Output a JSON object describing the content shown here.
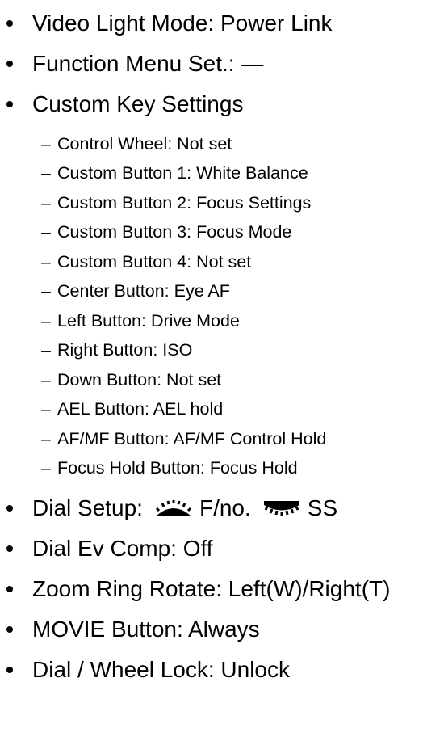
{
  "items_top": [
    {
      "label": "Video Light Mode: Power Link"
    },
    {
      "label": "Function Menu Set.: —"
    },
    {
      "label": "Custom Key Settings"
    }
  ],
  "custom_key": [
    "Control Wheel: Not set",
    "Custom Button 1: White Balance",
    "Custom Button 2: Focus Settings",
    "Custom Button 3: Focus Mode",
    "Custom Button 4: Not set",
    "Center Button: Eye AF",
    "Left Button: Drive Mode",
    "Right Button: ISO",
    "Down Button: Not set",
    "AEL Button: AEL hold",
    "AF/MF Button: AF/MF Control Hold",
    "Focus Hold Button: Focus Hold"
  ],
  "sub_marker": "–",
  "dial_setup": {
    "label": "Dial Setup:",
    "front_value": "F/no.",
    "rear_value": "SS",
    "front_icon": "front-dial-icon",
    "rear_icon": "rear-dial-icon"
  },
  "items_bottom": [
    {
      "label": "Dial Ev Comp: Off"
    },
    {
      "label": "Zoom Ring Rotate: Left(W)/Right(T)"
    },
    {
      "label": "MOVIE Button: Always"
    },
    {
      "label": "Dial / Wheel Lock: Unlock"
    }
  ]
}
